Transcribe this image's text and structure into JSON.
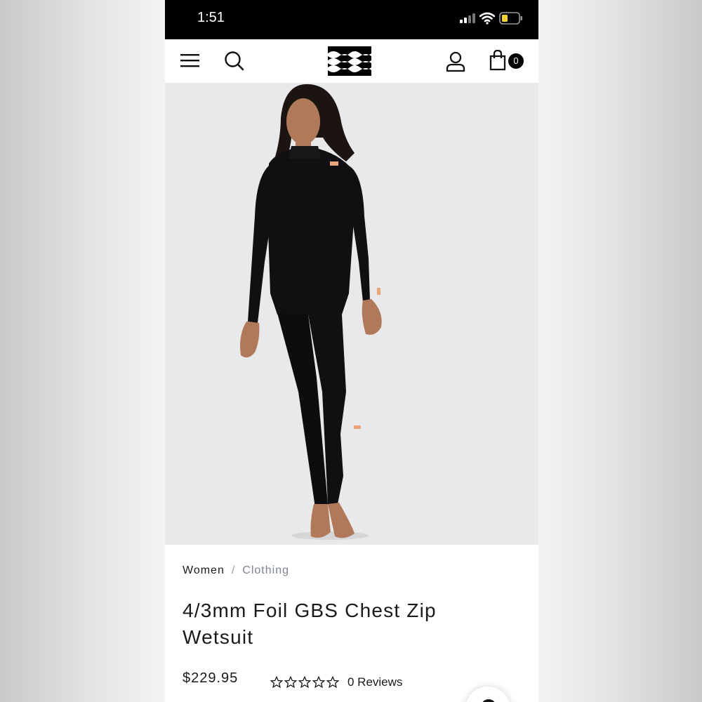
{
  "status_bar": {
    "time": "1:51",
    "icons": [
      "cellular-signal-icon",
      "wifi-icon",
      "battery-icon"
    ],
    "battery_color": "#f7d234"
  },
  "nav": {
    "icons": [
      "hamburger-menu-icon",
      "search-icon",
      "billabong-logo",
      "account-icon",
      "shopping-bag-icon"
    ],
    "cart_count": "0"
  },
  "product_image": {
    "subject": "woman wearing black full-length chest zip wetsuit",
    "background": "#e9e9eb"
  },
  "breadcrumb": {
    "items": [
      "Women",
      "Clothing"
    ],
    "separator": "/"
  },
  "product": {
    "title": "4/3mm Foil GBS Chest Zip Wetsuit",
    "price": "$229.95",
    "rating_stars": 0,
    "rating_max": 5,
    "reviews": "0 Reviews"
  },
  "colors": {
    "accent": "#000000",
    "text": "#1a1a1a",
    "muted_link": "#7d8390",
    "logo_accent": "#e8a47a"
  }
}
